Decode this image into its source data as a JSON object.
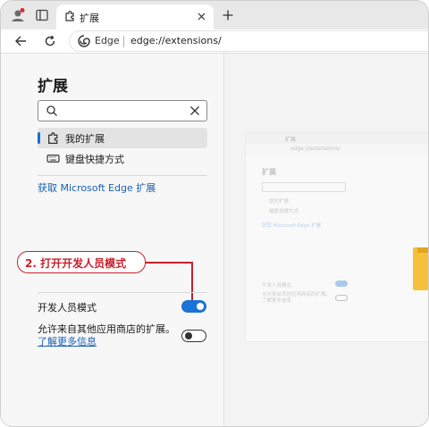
{
  "browser": {
    "tab": {
      "title": "扩展"
    },
    "address": {
      "brand": "Edge",
      "url": "edge://extensions/"
    }
  },
  "sidebar": {
    "title": "扩展",
    "search": {
      "value": "",
      "placeholder": ""
    },
    "items": [
      {
        "label": "我的扩展",
        "icon": "extension-icon",
        "active": true
      },
      {
        "label": "键盘快捷方式",
        "icon": "keyboard-icon",
        "active": false
      }
    ],
    "get_extensions_link": "获取 Microsoft Edge 扩展",
    "developer_mode": {
      "label": "开发人员模式",
      "enabled": true
    },
    "allow_other_stores": {
      "label": "允许来自其他应用商店的扩展。",
      "link": "了解更多信息",
      "enabled": false
    }
  },
  "annotation": {
    "callout": "2. 打开开发人员模式",
    "color": "#c8202c"
  },
  "colors": {
    "accent": "#1a73d6",
    "link": "#1a5fb4",
    "highlight": "#f6c13a"
  }
}
